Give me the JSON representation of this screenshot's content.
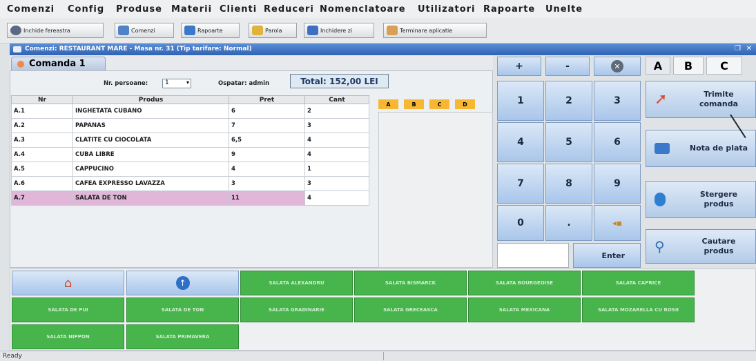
{
  "menu": [
    "Comenzi",
    "Config",
    "Produse",
    "Materii",
    "Clienti",
    "Reduceri",
    "Nomenclatoare",
    "Utilizatori",
    "Rapoarte",
    "Unelte"
  ],
  "toolbar": {
    "items": [
      {
        "label": "Inchide fereastra",
        "icon": "close-window-icon",
        "color": "#5a6a80"
      },
      {
        "label": "Comenzi",
        "icon": "orders-icon",
        "color": "#4f82c7"
      },
      {
        "label": "Rapoarte",
        "icon": "reports-icon",
        "color": "#3b78c9"
      },
      {
        "label": "Parola",
        "icon": "key-icon",
        "color": "#e2b33c"
      },
      {
        "label": "Inchidere zi",
        "icon": "close-day-icon",
        "color": "#3f6fc4"
      },
      {
        "label": "Terminare aplicatie",
        "icon": "exit-app-icon",
        "color": "#d9a055"
      }
    ]
  },
  "window": {
    "title": "Comenzi: RESTAURANT MARE - Masa nr. 31 (Tip tarifare: Normal)"
  },
  "order_tab": {
    "label": "Comanda 1"
  },
  "persons": {
    "label": "Nr. persoane:",
    "value": "1"
  },
  "operator": {
    "label": "Ospatar: admin"
  },
  "total": {
    "label": "Total: 152,00 LEI"
  },
  "table": {
    "headers": [
      "Nr",
      "Produs",
      "Pret",
      "Cant"
    ],
    "rows": [
      {
        "nr": "A.1",
        "produs": "INGHETATA CUBANO",
        "pret": "6",
        "cant": "2"
      },
      {
        "nr": "A.2",
        "produs": "PAPANAS",
        "pret": "7",
        "cant": "3"
      },
      {
        "nr": "A.3",
        "produs": "CLATITE CU CIOCOLATA",
        "pret": "6,5",
        "cant": "4"
      },
      {
        "nr": "A.4",
        "produs": "CUBA LIBRE",
        "pret": "9",
        "cant": "4"
      },
      {
        "nr": "A.5",
        "produs": "CAPPUCINO",
        "pret": "4",
        "cant": "1"
      },
      {
        "nr": "A.6",
        "produs": "CAFEA EXPRESSO LAVAZZA",
        "pret": "3",
        "cant": "3"
      },
      {
        "nr": "A.7",
        "produs": "SALATA DE TON",
        "pret": "11",
        "cant": "4"
      }
    ]
  },
  "category_tabs": [
    "A",
    "B",
    "C",
    "D"
  ],
  "keypad": {
    "top": [
      "+",
      "-"
    ],
    "digits": [
      "1",
      "2",
      "3",
      "4",
      "5",
      "6",
      "7",
      "8",
      "9",
      "0",
      "."
    ],
    "enter": "Enter"
  },
  "abc_tabs": [
    "A",
    "B",
    "C"
  ],
  "actions": {
    "send": "Trimite comanda",
    "bill": "Nota de plata",
    "delete": "Stergere produs",
    "search": "Cautare produs"
  },
  "products": [
    "SALATA ALEXANDRU",
    "SALATA BISMARCK",
    "SALATA BOURGEOISE",
    "SALATA CAPRICE",
    "SALATA DE PUI",
    "SALATA DE TON",
    "SALATA GRADINARIE",
    "SALATA GRECEASCA",
    "SALATA MEXICANA",
    "SALATA MOZARELLA CU ROSII",
    "SALATA NIPPON",
    "SALATA PRIMAVERA"
  ],
  "status": {
    "text": "Ready"
  }
}
